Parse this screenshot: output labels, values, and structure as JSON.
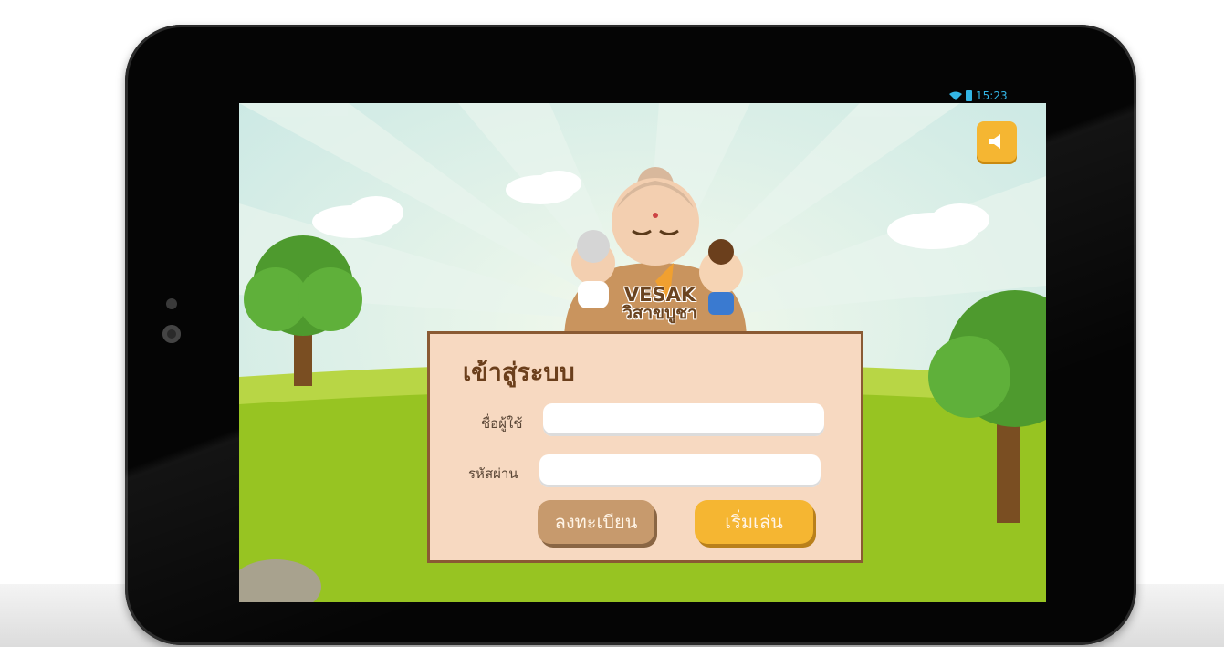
{
  "status_bar": {
    "time": "15:23"
  },
  "game": {
    "logo_en": "VESAK",
    "logo_th": "วิสาขบูชา"
  },
  "login": {
    "title": "เข้าสู่ระบบ",
    "username_label": "ชื่อผู้ใช้",
    "username_value": "",
    "password_label": "รหัสผ่าน",
    "password_value": "",
    "register_button": "ลงทะเบียน",
    "start_button": "เริ่มเล่น"
  },
  "icons": {
    "sound": "speaker-icon",
    "wifi": "wifi-icon",
    "battery": "battery-icon"
  },
  "colors": {
    "accent": "#f5b632",
    "panel": "#f7d9c1",
    "panel_border": "#8a5a33",
    "secondary_button": "#c79a6d"
  }
}
